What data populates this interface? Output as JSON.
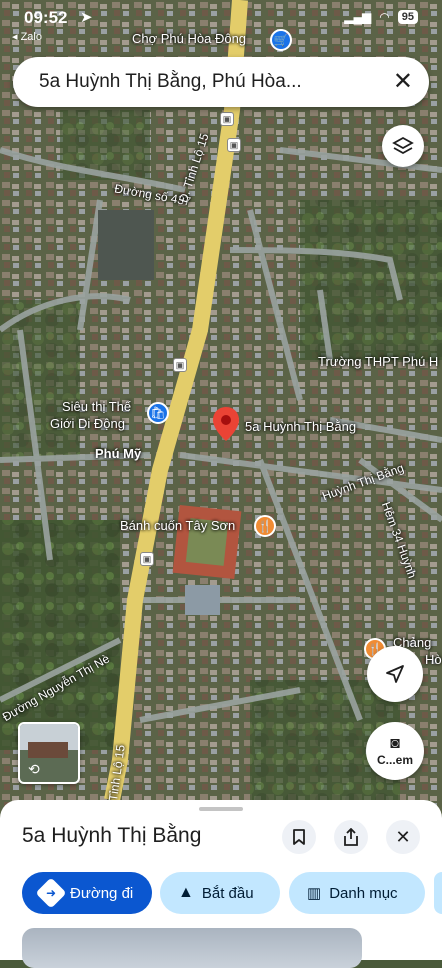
{
  "status_bar": {
    "time": "09:52",
    "back_app": "◂ Zalo",
    "battery": "95"
  },
  "search": {
    "query": "5a Huỳnh Thị Bằng, Phú Hòa..."
  },
  "map": {
    "labels": {
      "cho_phu_hoa_dong": "Chợ Phú Hòa Đông",
      "duong_so_437": "Đường số 437",
      "tinh_lo_15_top": "Đ. Tỉnh Lộ 15",
      "truong_thpt": "Trường THPT Phú H",
      "sieu_thi_1": "Siêu thị Thế",
      "sieu_thi_2": "Giới Di Động",
      "pin_label": "5a Huỳnh Thị Bằng",
      "phu_my": "Phú Mỹ",
      "huynh_thi_bang": "Huỳnh Thị Bằng",
      "hem_34": "Hẻm 34 Huỳnh",
      "banh_cuon": "Bánh cuốn Tây Sơn",
      "chang_1": "Chảng",
      "chang_2": "Hò",
      "nguyen_thi_ne": "Đường Nguyễn Thị Nè",
      "tinh_lo_15_bottom": "Tỉnh Lộ 15"
    },
    "camera_label": "C...em"
  },
  "place": {
    "title": "5a Huỳnh Thị Bằng",
    "actions": {
      "directions": "Đường đi",
      "start": "Bắt đầu",
      "category": "Danh mục"
    }
  },
  "colors": {
    "primary": "#0b57d0",
    "tonal": "#c2e7ff",
    "pin": "#ea4335",
    "road": "#e8d27a"
  }
}
